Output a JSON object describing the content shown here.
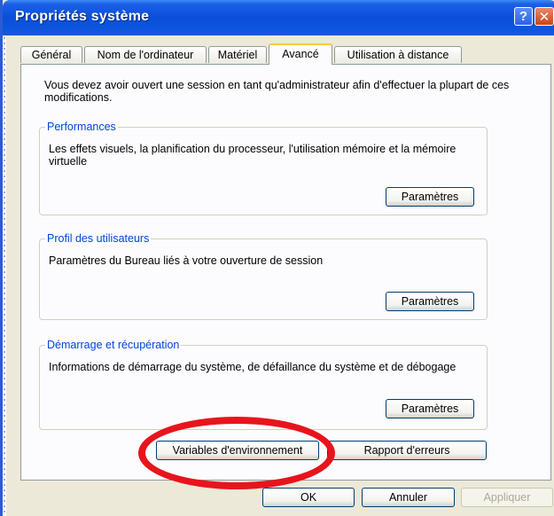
{
  "window": {
    "title": "Propriétés système",
    "help_label": "?",
    "close_label": "✕"
  },
  "tabs": [
    {
      "label": "Général"
    },
    {
      "label": "Nom de l'ordinateur"
    },
    {
      "label": "Matériel"
    },
    {
      "label": "Avancé",
      "active": true
    },
    {
      "label": "Utilisation à distance"
    }
  ],
  "intro_text": "Vous devez avoir ouvert une session en tant qu'administrateur afin d'effectuer la plupart de ces modifications.",
  "groups": [
    {
      "title": "Performances",
      "description": "Les effets visuels, la planification du processeur, l'utilisation mémoire et la mémoire virtuelle",
      "button_label": "Paramètres"
    },
    {
      "title": "Profil des utilisateurs",
      "description": "Paramètres du Bureau liés à votre ouverture de session",
      "button_label": "Paramètres"
    },
    {
      "title": "Démarrage et récupération",
      "description": "Informations de démarrage du système, de défaillance du système et de débogage",
      "button_label": "Paramètres"
    }
  ],
  "env_button_label": "Variables d'environnement",
  "error_report_button_label": "Rapport d'erreurs",
  "footer": {
    "ok_label": "OK",
    "cancel_label": "Annuler",
    "apply_label": "Appliquer"
  },
  "colors": {
    "titlebar": "#0a4fd8",
    "group_title": "#0046d5",
    "highlight_ring": "#e8141c",
    "active_tab_accent": "#ffc83c"
  }
}
